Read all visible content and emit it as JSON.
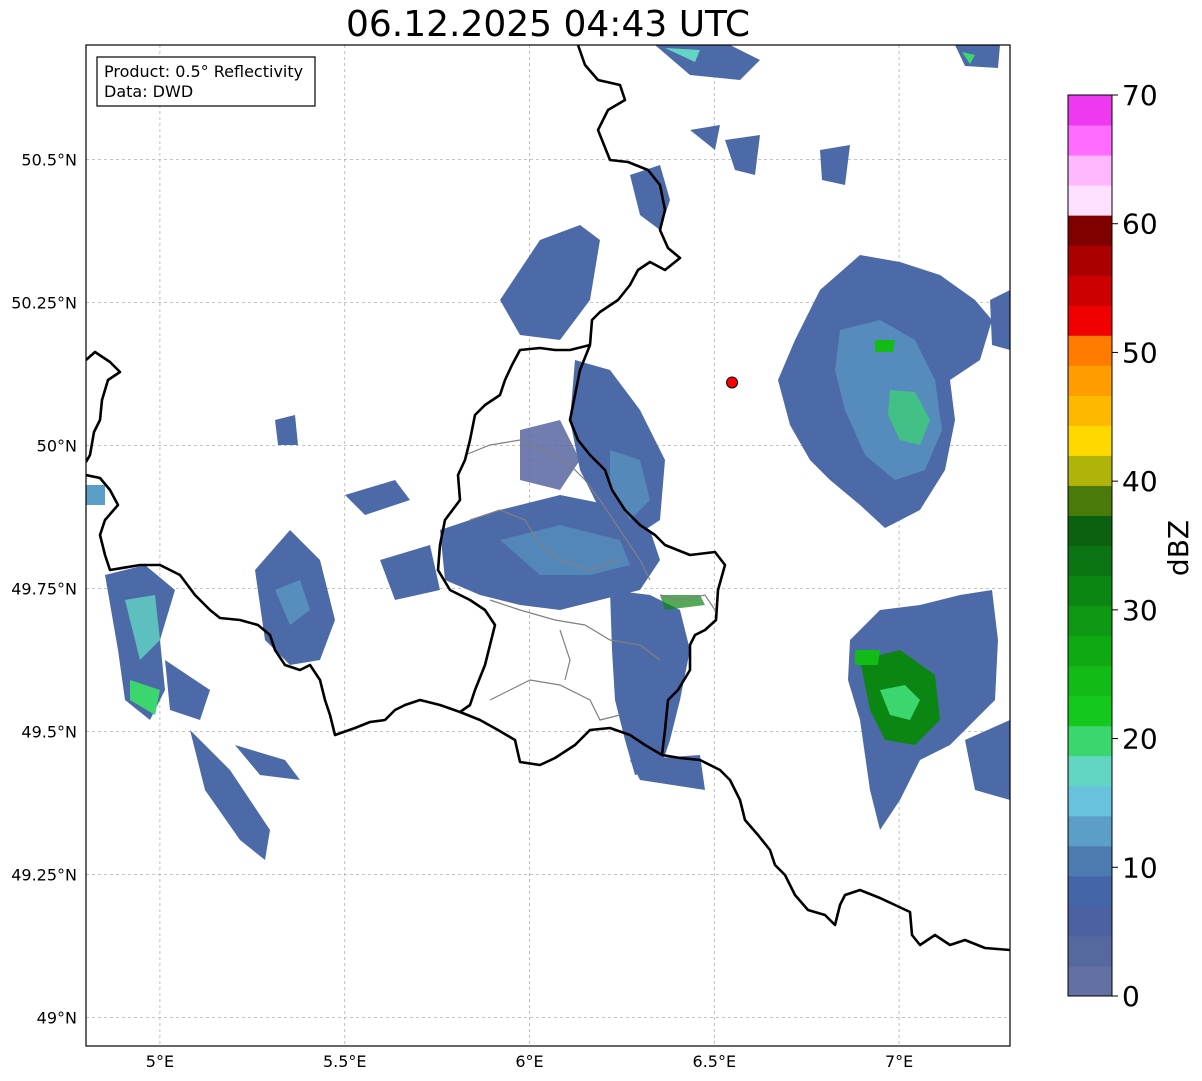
{
  "title": "06.12.2025 04:43 UTC",
  "info_box": {
    "product_line": "Product: 0.5° Reflectivity",
    "data_line": "Data: DWD"
  },
  "map_extent": {
    "lon_min": 4.8,
    "lon_max": 7.3,
    "lat_min": 48.95,
    "lat_max": 50.7
  },
  "lon_ticks": [
    {
      "value": 5.0,
      "label": "5°E"
    },
    {
      "value": 5.5,
      "label": "5.5°E"
    },
    {
      "value": 6.0,
      "label": "6°E"
    },
    {
      "value": 6.5,
      "label": "6.5°E"
    },
    {
      "value": 7.0,
      "label": "7°E"
    }
  ],
  "lat_ticks": [
    {
      "value": 49.0,
      "label": "49°N"
    },
    {
      "value": 49.25,
      "label": "49.25°N"
    },
    {
      "value": 49.5,
      "label": "49.5°N"
    },
    {
      "value": 49.75,
      "label": "49.75°N"
    },
    {
      "value": 50.0,
      "label": "50°N"
    },
    {
      "value": 50.25,
      "label": "50.25°N"
    },
    {
      "value": 50.5,
      "label": "50.5°N"
    }
  ],
  "radar_site": {
    "lon": 6.548,
    "lat": 50.11,
    "color": "#ff0000"
  },
  "colorbar": {
    "label": "dBZ",
    "min": 0,
    "max": 70,
    "ticks": [
      0,
      10,
      20,
      30,
      40,
      50,
      60,
      70
    ],
    "tick_labels": [
      "0",
      "10",
      "20",
      "30",
      "40",
      "50",
      "60",
      "70"
    ],
    "colors": [
      "#6370a4",
      "#56699f",
      "#4c61a1",
      "#4466a6",
      "#4d7ab0",
      "#5b9ec7",
      "#69c2dd",
      "#63d6c3",
      "#3cd66e",
      "#14c81e",
      "#12bb17",
      "#0fa912",
      "#0e9813",
      "#0c8613",
      "#0c7513",
      "#0b610f",
      "#4a7a0a",
      "#b0b40a",
      "#ffd800",
      "#ffb800",
      "#ff9c00",
      "#ff7c00",
      "#f00000",
      "#cc0000",
      "#aa0000",
      "#800000",
      "#ffe0ff",
      "#ffb8ff",
      "#ff6cff",
      "#ee3aee"
    ]
  },
  "colors": {
    "country_border": "#000000",
    "region_border": "#808080",
    "grid": "#b0b0b0"
  }
}
